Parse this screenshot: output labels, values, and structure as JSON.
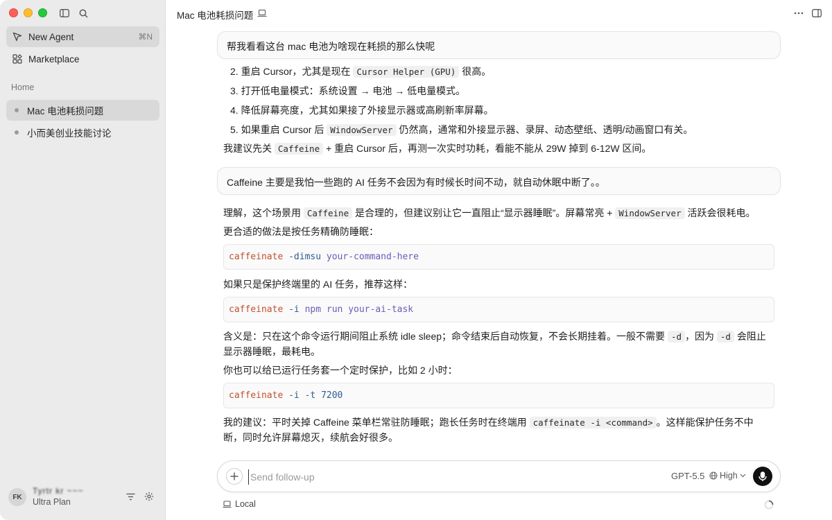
{
  "sidebar": {
    "new_agent_label": "New Agent",
    "new_agent_shortcut": "⌘N",
    "marketplace_label": "Marketplace",
    "section_title": "Home",
    "chats": [
      {
        "label": "Mac 电池耗损问题"
      },
      {
        "label": "小而美创业技能讨论"
      }
    ],
    "user": {
      "initials": "FK",
      "name": "Tyrtr kr  ~~~",
      "plan": "Ultra Plan"
    }
  },
  "header": {
    "title": "Mac 电池耗损问题"
  },
  "conversation": {
    "user_msg_1": "帮我看看这台 mac 电池为啥现在耗损的那么快呢",
    "list": {
      "i2_num": "2.",
      "i2_a": "重启 Cursor，尤其是现在 ",
      "i2_code": "Cursor Helper (GPU)",
      "i2_b": " 很高。",
      "i3_num": "3.",
      "i3": "打开低电量模式：系统设置 → 电池 → 低电量模式。",
      "i4_num": "4.",
      "i4": "降低屏幕亮度，尤其如果接了外接显示器或高刷新率屏幕。",
      "i5_num": "5.",
      "i5_a": "如果重启 Cursor 后 ",
      "i5_code": "WindowServer",
      "i5_b": " 仍然高，通常和外接显示器、录屏、动态壁纸、透明/动画窗口有关。"
    },
    "rec_a": "我建议先关 ",
    "rec_code": "Caffeine",
    "rec_b": " + 重启 Cursor 后，再测一次实时功耗，看能不能从 29W 掉到 6-12W 区间。",
    "user_msg_2": "Caffeine 主要是我怕一些跑的 AI 任务不会因为有时候长时间不动，就自动休眠中断了。。",
    "p1_a": "理解，这个场景用 ",
    "p1_code1": "Caffeine",
    "p1_b": " 是合理的，但建议别让它一直阻止“显示器睡眠”。屏幕常亮 + ",
    "p1_code2": "WindowServer",
    "p1_c": " 活跃会很耗电。",
    "p2": "更合适的做法是按任务精确防睡眠：",
    "code1": {
      "cmd": "caffeinate",
      "flag": "-dimsu",
      "arg": "your-command-here"
    },
    "p3": "如果只是保护终端里的 AI 任务，推荐这样：",
    "code2": {
      "cmd": "caffeinate",
      "flag": "-i",
      "arg": "npm run your-ai-task"
    },
    "p4_a": "含义是：只在这个命令运行期间阻止系统 idle sleep；命令结束后自动恢复，不会长期挂着。一般不需要 ",
    "p4_code1": "-d",
    "p4_b": "，因为 ",
    "p4_code2": "-d",
    "p4_c": " 会阻止",
    "p4_d": "显示器睡眠，最耗电。",
    "p5": "你也可以给已运行任务套一个定时保护，比如 2 小时：",
    "code3": {
      "cmd": "caffeinate",
      "flag": "-i -t",
      "arg": "7200"
    },
    "p6_a": "我的建议：平时关掉 Caffeine 菜单栏常驻防睡眠；跑长任务时在终端用 ",
    "p6_code": "caffeinate -i <command>",
    "p6_b": "。这样能保护任务不中",
    "p6_c": "断，同时允许屏幕熄灭，续航会好很多。"
  },
  "composer": {
    "placeholder": "Send follow-up",
    "model": "GPT-5.5",
    "effort": "High",
    "location": "Local"
  }
}
